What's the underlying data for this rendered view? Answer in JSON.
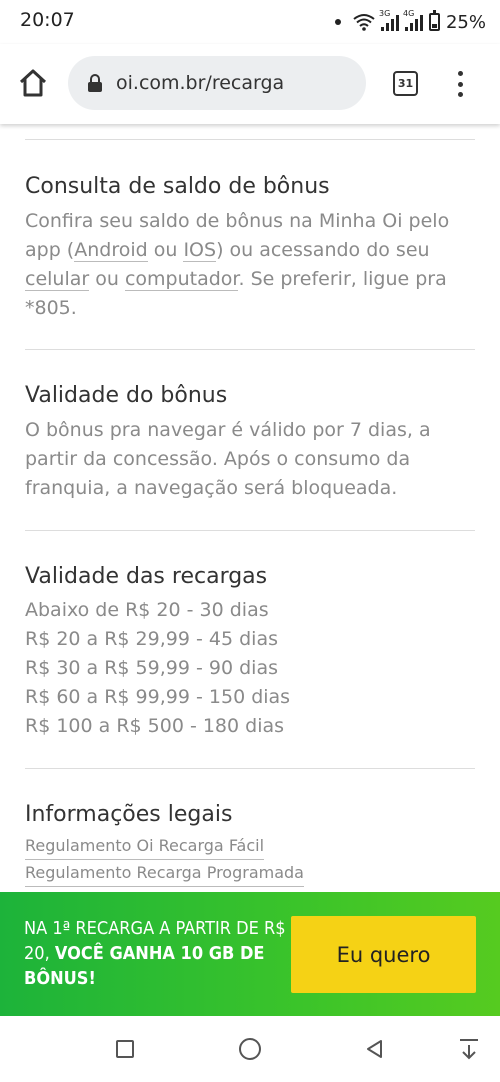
{
  "status_bar": {
    "time": "20:07",
    "network_tag_1": "3G",
    "network_tag_2": "4G",
    "battery": "25%"
  },
  "browser": {
    "url": "oi.com.br/recarga",
    "tab_count": "31",
    "icons": [
      "home-icon",
      "lock-icon",
      "tabs-icon",
      "menu-icon"
    ]
  },
  "sections": {
    "saldo": {
      "title": "Consulta de saldo de bônus",
      "text_1": "Confira seu saldo de bônus na Minha Oi pelo app (",
      "link_android": "Android",
      "text_2": " ou ",
      "link_ios": "IOS",
      "text_3": ") ou acessando do seu ",
      "link_celular": "celular",
      "text_4": " ou ",
      "link_computador": "computador",
      "text_5": ". Se preferir, ligue pra *805."
    },
    "validade_bonus": {
      "title": "Validade do bônus",
      "body": "O bônus pra navegar é válido por 7 dias, a partir da concessão. Após o consumo da franquia, a navegação será bloqueada."
    },
    "validade_recargas": {
      "title": "Validade das recargas",
      "items": [
        "Abaixo de R$ 20 - 30 dias",
        "R$ 20 a R$ 29,99 - 45 dias",
        "R$ 30 a R$ 59,99 - 90 dias",
        "R$ 60 a R$ 99,99 - 150 dias",
        "R$ 100 a R$ 500 - 180 dias"
      ]
    },
    "legais": {
      "title": "Informações legais",
      "links": [
        "Regulamento Oi Recarga Fácil",
        "Regulamento Recarga Programada"
      ]
    }
  },
  "promo": {
    "text_normal": "NA 1ª RECARGA A PARTIR DE R$ 20, ",
    "text_bold": "VOCÊ GANHA 10 GB DE BÔNUS!",
    "button": "Eu quero",
    "colors": {
      "banner": "#2ebd2f",
      "button": "#f5d215"
    }
  },
  "navbar": {
    "icons": [
      "recents-icon",
      "home-circle-icon",
      "back-icon",
      "notifications-pull-icon"
    ]
  }
}
